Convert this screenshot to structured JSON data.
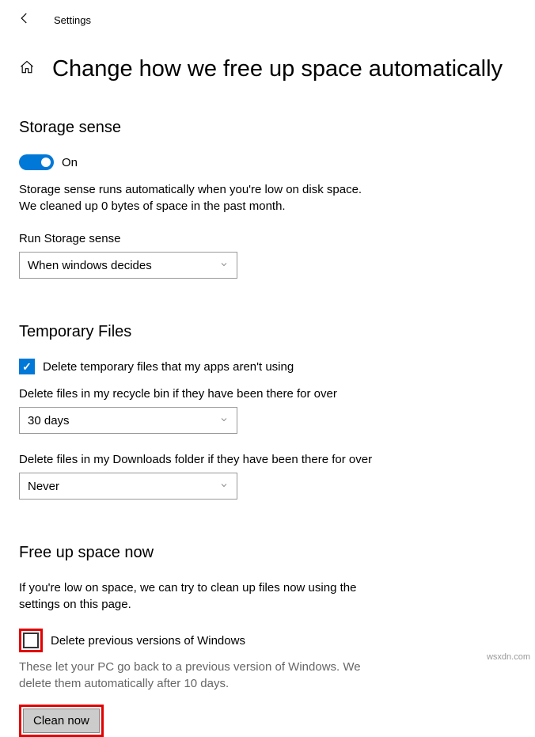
{
  "titlebar": {
    "label": "Settings"
  },
  "page": {
    "title": "Change how we free up space automatically"
  },
  "storage": {
    "heading": "Storage sense",
    "toggle_label": "On",
    "desc_line1": "Storage sense runs automatically when you're low on disk space.",
    "desc_line2": "We cleaned up 0 bytes of space in the past month.",
    "run_label": "Run Storage sense",
    "run_value": "When windows decides"
  },
  "temp": {
    "heading": "Temporary Files",
    "cb1_label": "Delete temporary files that my apps aren't using",
    "recycle_label": "Delete files in my recycle bin if they have been there for over",
    "recycle_value": "30 days",
    "downloads_label": "Delete files in my Downloads folder if they have been there for over",
    "downloads_value": "Never"
  },
  "freeup": {
    "heading": "Free up space now",
    "desc": "If you're low on space, we can try to clean up files now using the settings on this page.",
    "cb_label": "Delete previous versions of Windows",
    "note": "These let your PC go back to a previous version of Windows. We delete them automatically after 10 days.",
    "button": "Clean now"
  },
  "watermark": "wsxdn.com"
}
